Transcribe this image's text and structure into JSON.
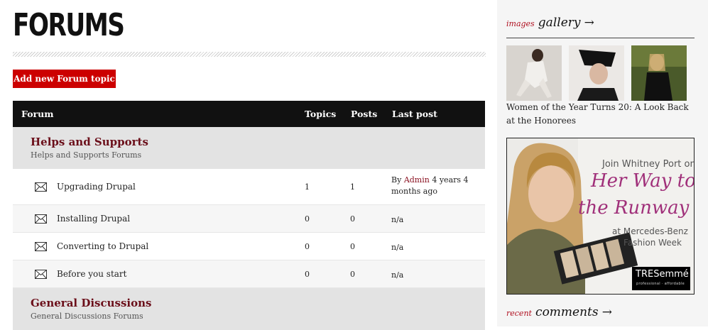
{
  "page": {
    "title": "FORUMS",
    "add_button": "Add new Forum topic"
  },
  "table": {
    "headers": {
      "forum": "Forum",
      "topics": "Topics",
      "posts": "Posts",
      "last_post": "Last post"
    },
    "categories": [
      {
        "title": "Helps and Supports",
        "subtitle": "Helps and Supports Forums",
        "forums": [
          {
            "name": "Upgrading Drupal",
            "topics": "1",
            "posts": "1",
            "last_post_prefix": "By",
            "last_post_author": "Admin",
            "last_post_time": "4 years 4 months ago",
            "icon": "envelope-icon"
          },
          {
            "name": "Installing Drupal",
            "topics": "0",
            "posts": "0",
            "last_post": "n/a",
            "icon": "envelope-icon"
          },
          {
            "name": "Converting to Drupal",
            "topics": "0",
            "posts": "0",
            "last_post": "n/a",
            "icon": "envelope-icon"
          },
          {
            "name": "Before you start",
            "topics": "0",
            "posts": "0",
            "last_post": "n/a",
            "icon": "envelope-icon"
          }
        ]
      },
      {
        "title": "General Discussions",
        "subtitle": "General Discussions Forums"
      }
    ]
  },
  "sidebar": {
    "gallery": {
      "prefix": "images",
      "title": "gallery",
      "arrow": "→",
      "caption": "Women of the Year Turns 20: A Look Back at the Honorees"
    },
    "ad": {
      "line1": "Join Whitney Port on",
      "line2": "Her Way to",
      "line3": "the Runway",
      "line4": "at Mercedes-Benz",
      "line5": "Fashion Week",
      "brand": "TRESemmé",
      "brand_tag": "professional · affordable"
    },
    "comments": {
      "prefix": "recent",
      "title": "comments",
      "arrow": "→"
    }
  },
  "colors": {
    "accent_red": "#cc0000",
    "category_title": "#6b0f1a",
    "header_bg": "#111111",
    "category_bg": "#e3e3e3",
    "sidebar_bg": "#f5f5f5"
  }
}
